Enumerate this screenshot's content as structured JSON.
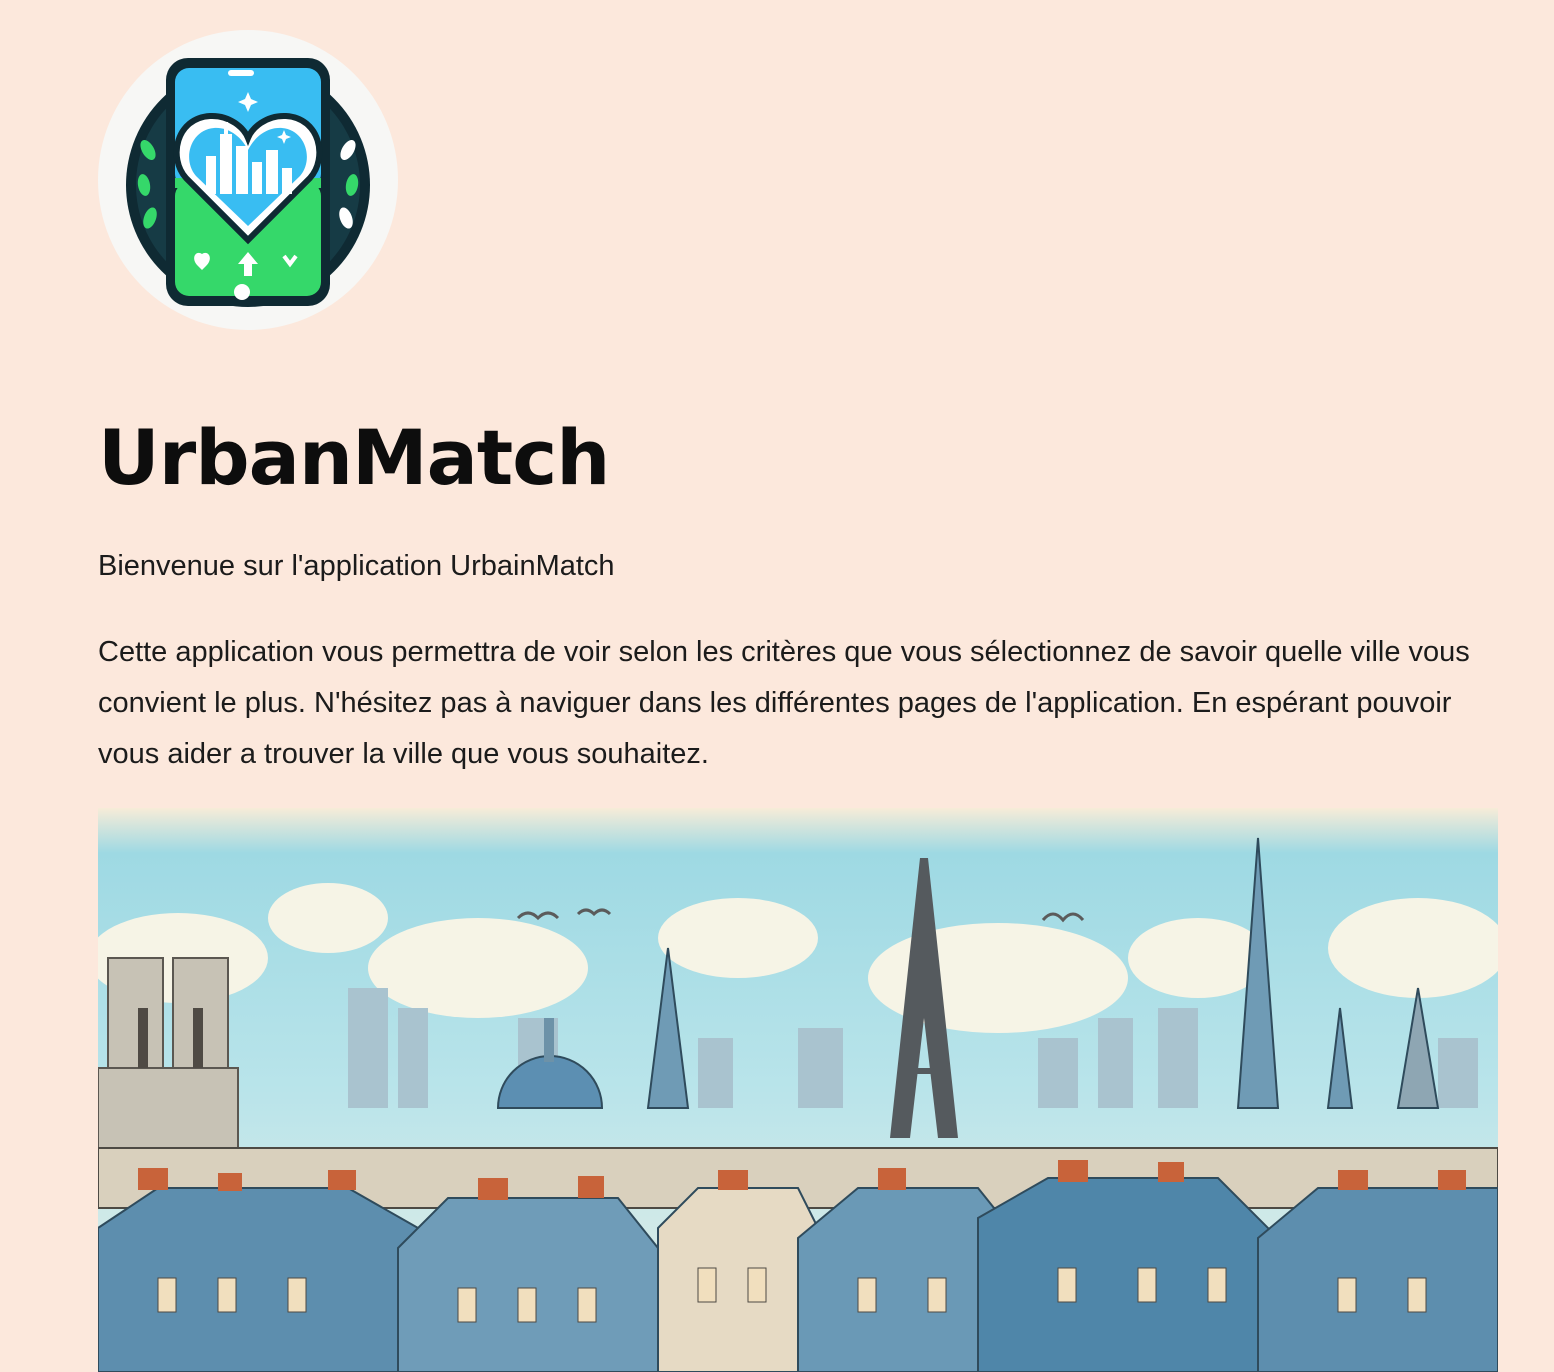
{
  "app": {
    "title": "UrbanMatch",
    "logo_icon": "city-heart-phone-logo",
    "colors": {
      "background": "#fce8dc",
      "logo_blue": "#39bdf2",
      "logo_green": "#35d86a",
      "logo_dark": "#0f2a33"
    }
  },
  "main": {
    "subtitle": "Bienvenue sur l'application UrbainMatch",
    "description": "Cette application vous permettra de voir selon les critères que vous sélectionnez de savoir quelle ville vous convient le plus. N'hésitez pas à naviguer dans les différentes pages de l'application. En espérant pouvoir vous aider a trouver la ville que vous souhaitez.",
    "hero_image": "paris-skyline-illustration"
  }
}
